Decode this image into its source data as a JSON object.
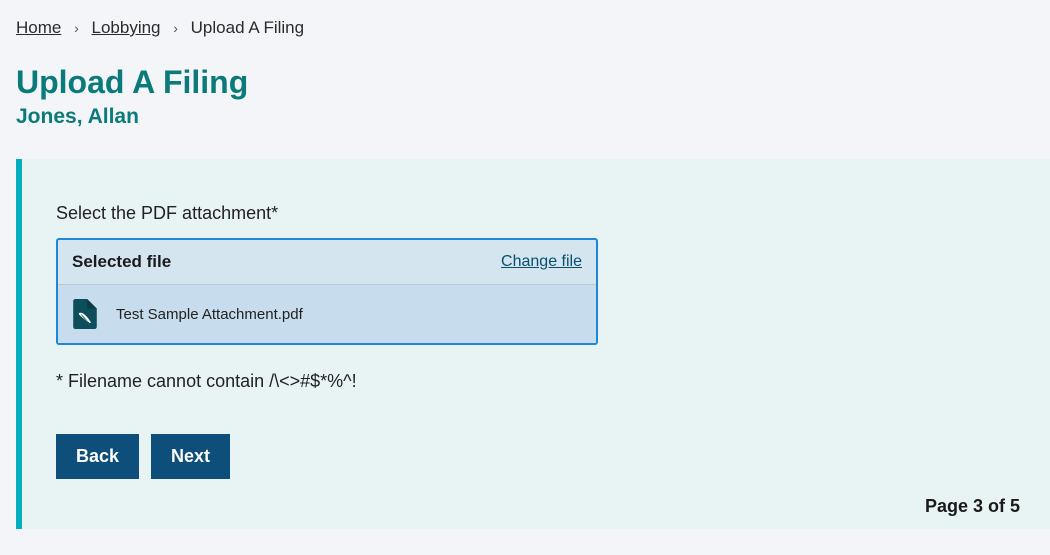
{
  "breadcrumb": {
    "home": "Home",
    "lobbying": "Lobbying",
    "current": "Upload A Filing"
  },
  "page_title": "Upload A Filing",
  "subtitle": "Jones, Allan",
  "form": {
    "field_label": "Select the PDF attachment*",
    "selected_file_label": "Selected file",
    "change_file": "Change file",
    "file_name": "Test Sample Attachment.pdf",
    "helper_text": "* Filename cannot contain /\\<>#$*%^!",
    "back": "Back",
    "next": "Next"
  },
  "pagination": "Page 3 of 5"
}
